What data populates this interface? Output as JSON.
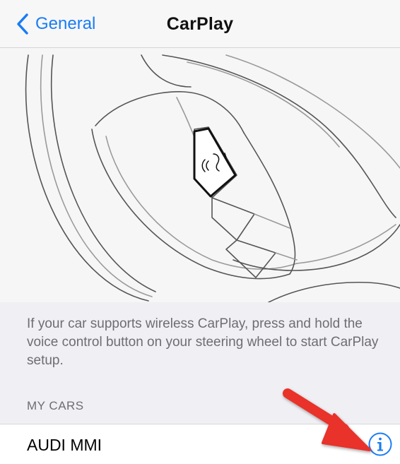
{
  "navbar": {
    "back_label": "General",
    "title": "CarPlay"
  },
  "instructions": {
    "text": "If your car supports wireless CarPlay, press and hold the voice control button on your steering wheel to start CarPlay setup."
  },
  "my_cars": {
    "header": "MY CARS",
    "cars": [
      {
        "name": "AUDI MMI"
      }
    ]
  },
  "icons": {
    "back": "chevron-left-icon",
    "info": "info-circle-icon",
    "voice": "voice-control-icon",
    "annotation": "red-arrow-icon"
  },
  "colors": {
    "accent": "#1a7cf5",
    "background": "#efeff4",
    "secondary_text": "#6d6d72",
    "arrow": "#e8332a"
  }
}
